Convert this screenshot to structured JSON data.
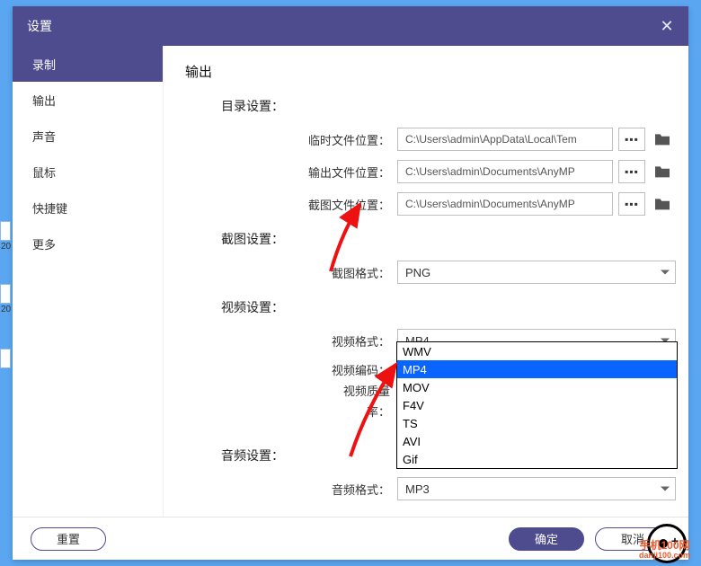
{
  "window": {
    "title": "设置",
    "close_glyph": "✕"
  },
  "sidebar": {
    "items": [
      {
        "label": "录制",
        "active": true
      },
      {
        "label": "输出"
      },
      {
        "label": "声音"
      },
      {
        "label": "鼠标"
      },
      {
        "label": "快捷键"
      },
      {
        "label": "更多"
      }
    ]
  },
  "main": {
    "page_title": "输出",
    "dir_section": {
      "title": "目录设置：",
      "rows": [
        {
          "label": "临时文件位置：",
          "value": "C:\\Users\\admin\\AppData\\Local\\Tem"
        },
        {
          "label": "输出文件位置：",
          "value": "C:\\Users\\admin\\Documents\\AnyMP"
        },
        {
          "label": "截图文件位置：",
          "value": "C:\\Users\\admin\\Documents\\AnyMP"
        }
      ]
    },
    "screenshot_section": {
      "title": "截图设置：",
      "format_label": "截图格式：",
      "format_value": "PNG"
    },
    "video_section": {
      "title": "视频设置：",
      "format_label": "视频格式：",
      "format_value": "MP4",
      "codec_label": "视频编码：",
      "quality_label": "视频质量",
      "rate_label": "率：",
      "dropdown_options": [
        "WMV",
        "MP4",
        "MOV",
        "F4V",
        "TS",
        "AVI",
        "Gif"
      ],
      "dropdown_selected": "MP4"
    },
    "audio_section": {
      "title": "音频设置：",
      "format_label": "音频格式：",
      "format_value": "MP3"
    }
  },
  "footer": {
    "reset": "重置",
    "ok": "确定",
    "cancel": "取消"
  },
  "more_glyph": "▪▪▪",
  "watermark": {
    "l1": "手机100网",
    "l2": "danji100.com"
  },
  "peek": {
    "a": "20",
    "b": "20"
  }
}
